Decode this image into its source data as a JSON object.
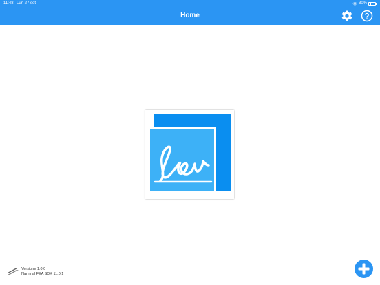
{
  "status_bar": {
    "time": "11:48",
    "date": "Lun 27 set",
    "battery_percent": "30%",
    "battery_level": 0.3,
    "icons": [
      "wifi-icon",
      "battery-icon"
    ]
  },
  "nav": {
    "title": "Home",
    "settings_icon": "gear-icon",
    "help_icon": "question-mark-icon"
  },
  "logo": {
    "icon": "signature-logo-icon"
  },
  "footer": {
    "version": "Versione 1.0.0",
    "sdk": "Namirial FEA SDK 11.0.1",
    "icon": "namirial-logo-icon"
  },
  "fab": {
    "icon": "plus-icon"
  },
  "colors": {
    "accent": "#2B95F3",
    "logo_dark_blue": "#0A8EF0",
    "logo_light_blue": "#3DB1F7"
  }
}
